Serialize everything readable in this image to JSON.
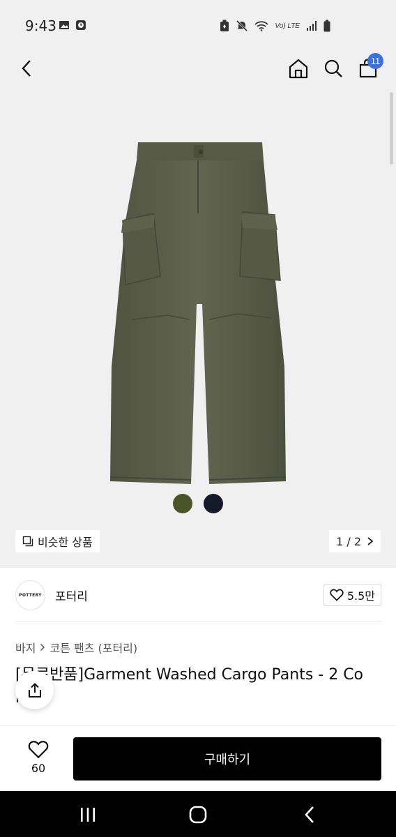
{
  "status_bar": {
    "time": "9:43",
    "icons_left": [
      "image-icon",
      "clock-app-icon"
    ],
    "icons_right": [
      "battery-saver-icon",
      "mute-icon",
      "wifi-icon",
      "volte-icon",
      "signal-icon",
      "battery-icon"
    ],
    "volte_label": "Vo) LTE"
  },
  "header": {
    "icons": [
      "back-icon",
      "home-icon",
      "search-icon",
      "shopping-bag-icon"
    ],
    "cart_count": "11"
  },
  "gallery": {
    "swatches": [
      {
        "name": "olive",
        "color": "#4a5426"
      },
      {
        "name": "navy",
        "color": "#151a2b"
      }
    ],
    "similar_label": "비슷한 상품",
    "page_indicator": "1 / 2",
    "pants_color": "#5c6049",
    "background": "#f0f0f0"
  },
  "brand": {
    "logo_text": "POTTERY",
    "name": "포터리",
    "likes": "5.5만"
  },
  "product": {
    "breadcrumb": [
      "바지",
      "코튼 팬츠 (포터리)"
    ],
    "title_line1": "[무료반품]Garment Washed Cargo Pants - 2 Co",
    "title_line2": "lor"
  },
  "buy_bar": {
    "wish_count": "60",
    "buy_label": "구매하기"
  },
  "system_nav": {
    "icons": [
      "recent-apps-icon",
      "home-nav-icon",
      "back-nav-icon"
    ]
  }
}
